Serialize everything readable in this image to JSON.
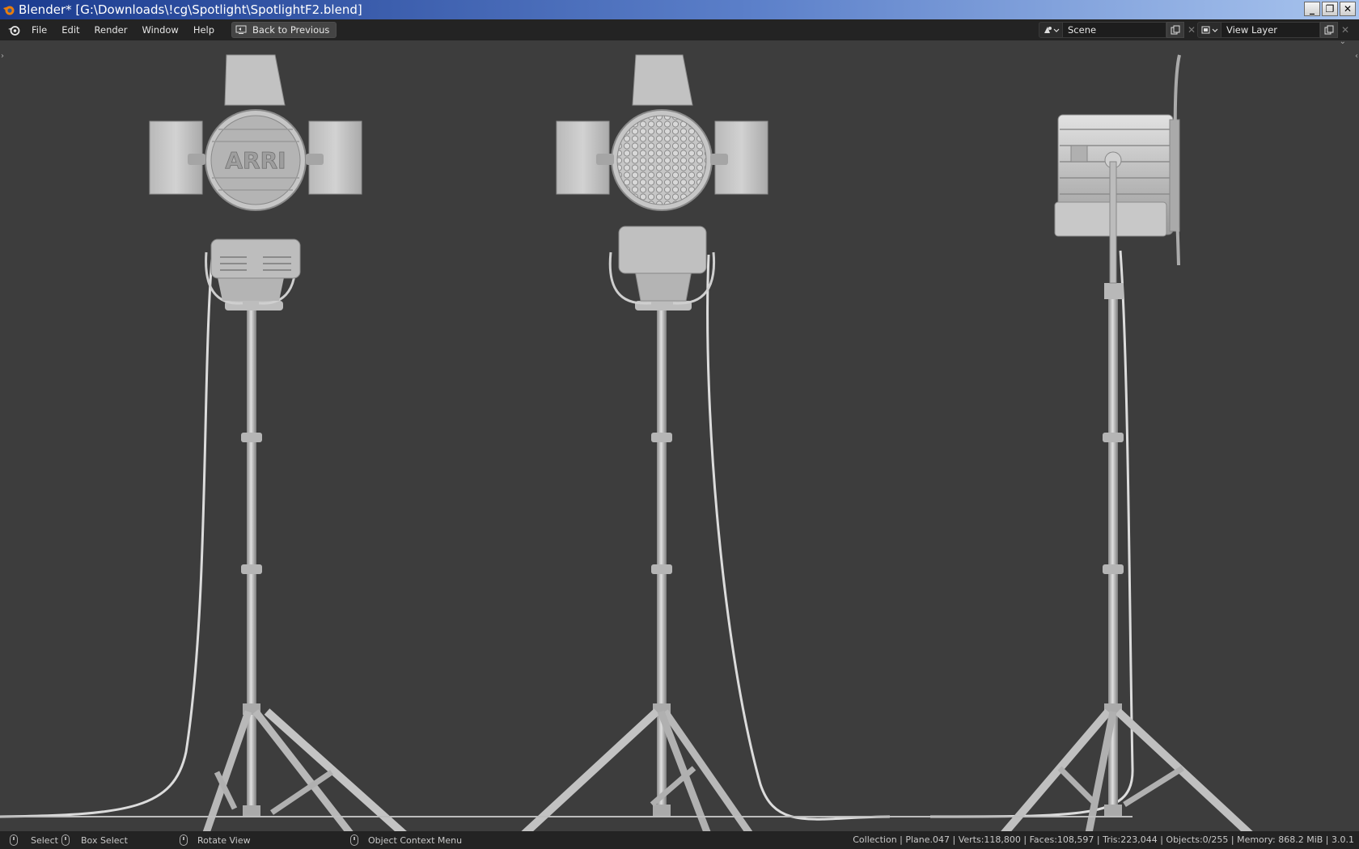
{
  "window": {
    "title": "Blender* [G:\\Downloads\\!cg\\Spotlight\\SpotlightF2.blend]",
    "minimize_glyph": "_",
    "restore_glyph": "❐",
    "close_glyph": "✕"
  },
  "menubar": {
    "items": [
      {
        "label": "File"
      },
      {
        "label": "Edit"
      },
      {
        "label": "Render"
      },
      {
        "label": "Window"
      },
      {
        "label": "Help"
      }
    ],
    "back_button": "Back to Previous",
    "scene": {
      "value": "Scene",
      "icon": "scene-icon"
    },
    "view_layer": {
      "value": "View Layer",
      "icon": "view-layer-icon"
    }
  },
  "viewport": {
    "lamp_logo_text": "ARRI"
  },
  "statusbar": {
    "hints": [
      {
        "label": "Select"
      },
      {
        "label": "Box Select"
      },
      {
        "label": "Rotate View"
      },
      {
        "label": "Object Context Menu"
      }
    ],
    "stats": "Collection | Plane.047 | Verts:118,800 | Faces:108,597 | Tris:223,044 | Objects:0/255 | Memory: 868.2 MiB | 3.0.1"
  },
  "colors": {
    "viewport_bg": "#3d3d3d",
    "header_bg": "#232323",
    "model_grey": "#c8c8c8"
  }
}
